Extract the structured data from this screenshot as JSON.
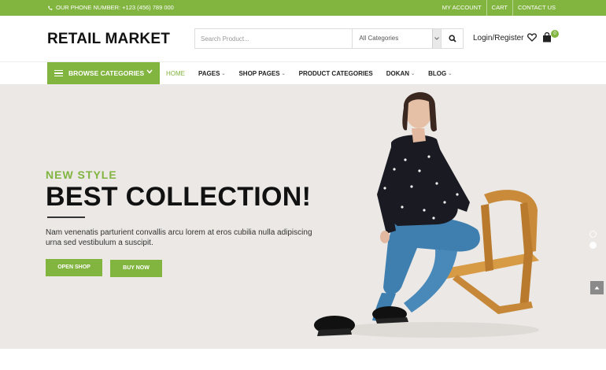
{
  "topbar": {
    "phone_label": "OUR PHONE NUMBER: +123 (456) 789 000",
    "links": [
      "MY ACCOUNT",
      "CART",
      "CONTACT US"
    ]
  },
  "header": {
    "logo": "RETAIL MARKET",
    "search_placeholder": "Search Product...",
    "category_selected": "All Categories",
    "login_label": "Login/Register",
    "cart_count": "0"
  },
  "nav": {
    "browse_label": "BROWSE CATEGORIES",
    "items": [
      {
        "label": "HOME",
        "caret": ""
      },
      {
        "label": "PAGES",
        "caret": "⌄"
      },
      {
        "label": "SHOP PAGES",
        "caret": "⌄"
      },
      {
        "label": "PRODUCT CATEGORIES",
        "caret": ""
      },
      {
        "label": "DOKAN",
        "caret": "⌄"
      },
      {
        "label": "BLOG",
        "caret": "⌄"
      }
    ]
  },
  "hero": {
    "eyebrow": "NEW STYLE",
    "headline": "BEST COLLECTION!",
    "description": "Nam venenatis parturient convallis arcu lorem at eros cubilia nulla adipiscing urna sed vestibulum a suscipit.",
    "btn_open_shop": "OPEN SHOP",
    "btn_buy_now": "BUY NOW"
  },
  "colors": {
    "accent": "#82b440",
    "hero_bg": "#ebe8e5"
  }
}
